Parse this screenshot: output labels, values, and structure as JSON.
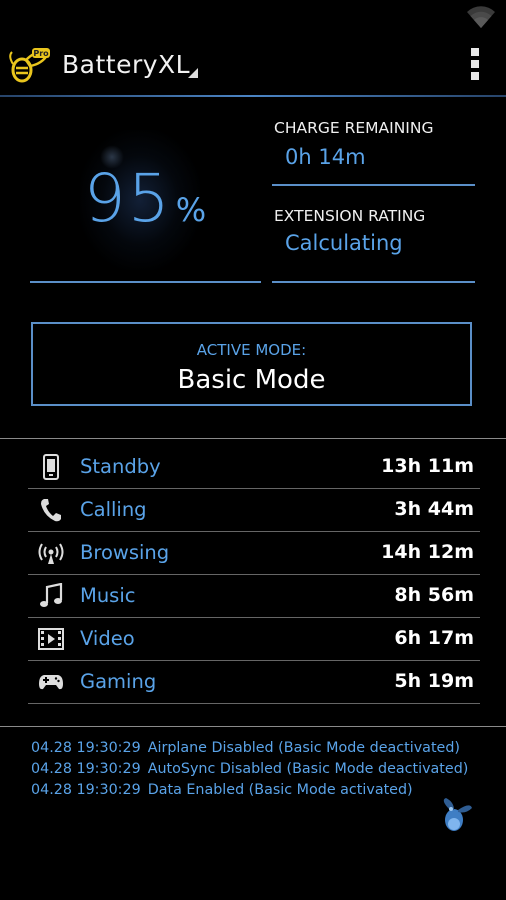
{
  "app": {
    "title": "BatteryXL"
  },
  "battery": {
    "percent": "95",
    "percent_sign": "%"
  },
  "charge": {
    "label": "CHARGE REMAINING",
    "value": "0h 14m"
  },
  "extension": {
    "label": "EXTENSION RATING",
    "value": "Calculating"
  },
  "mode": {
    "label": "ACTIVE MODE:",
    "value": "Basic Mode"
  },
  "usage": [
    {
      "name": "Standby",
      "time": "13h 11m",
      "icon": "phone-standby-icon"
    },
    {
      "name": "Calling",
      "time": "3h 44m",
      "icon": "phone-handset-icon"
    },
    {
      "name": "Browsing",
      "time": "14h 12m",
      "icon": "antenna-signal-icon"
    },
    {
      "name": "Music",
      "time": "8h 56m",
      "icon": "music-note-icon"
    },
    {
      "name": "Video",
      "time": "6h 17m",
      "icon": "film-strip-icon"
    },
    {
      "name": "Gaming",
      "time": "5h 19m",
      "icon": "gamepad-icon"
    }
  ],
  "log": [
    {
      "ts": "04.28 19:30:29",
      "msg": "Airplane Disabled (Basic Mode deactivated)"
    },
    {
      "ts": "04.28 19:30:29",
      "msg": "AutoSync Disabled (Basic Mode deactivated)"
    },
    {
      "ts": "04.28 19:30:29",
      "msg": "Data Enabled (Basic Mode activated)"
    }
  ],
  "colors": {
    "accent": "#5aa3e8",
    "line": "#5b8fc8",
    "background": "#000000"
  }
}
